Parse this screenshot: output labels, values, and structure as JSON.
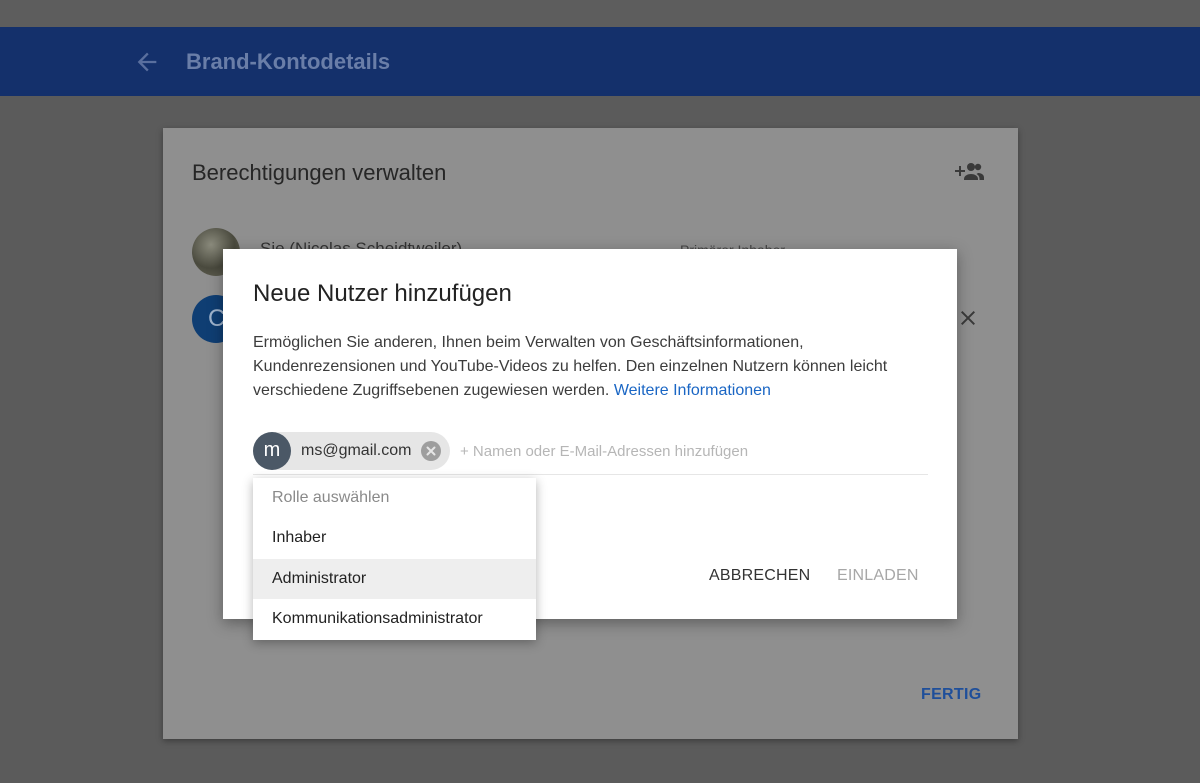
{
  "header": {
    "title": "Brand-Kontodetails",
    "back_icon": "arrow-left-icon"
  },
  "permissions_card": {
    "title": "Berechtigungen verwalten",
    "members": [
      {
        "name": "Sie (Nicolas Scheidtweiler)",
        "role": "Primärer Inhaber"
      },
      {
        "avatar_letter": "C"
      }
    ],
    "done_label": "FERTIG"
  },
  "dialog": {
    "title": "Neue Nutzer hinzufügen",
    "description": "Ermöglichen Sie anderen, Ihnen beim Verwalten von Geschäftsinformationen, Kundenrezensionen und YouTube-Videos zu helfen. Den einzelnen Nutzern können leicht verschiedene Zugriffsebenen zugewiesen werden.",
    "link_text": "Weitere Informationen",
    "chip": {
      "avatar_letter": "m",
      "email": "ms@gmail.com"
    },
    "recipient_placeholder": "+ Namen oder E-Mail-Adressen hinzufügen",
    "cancel_label": "ABBRECHEN",
    "invite_label": "EINLADEN"
  },
  "role_menu": {
    "placeholder": "Rolle auswählen",
    "options": [
      "Inhaber",
      "Administrator",
      "Kommunikationsadministrator"
    ],
    "highlighted": "Administrator"
  },
  "colors": {
    "header_bg": "#14306b",
    "overlay_bg": "#5b5b5b",
    "link": "#1a66c4",
    "done": "#1f4f9a"
  }
}
